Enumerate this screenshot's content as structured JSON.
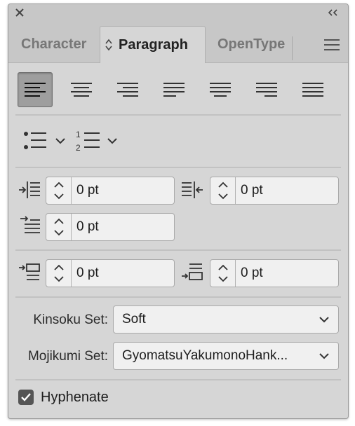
{
  "titlebar": {
    "close_icon": "close-icon",
    "collapse_icon": "double-chevron-left-icon"
  },
  "tabs": [
    {
      "label": "Character",
      "active": false
    },
    {
      "label": "Paragraph",
      "active": true,
      "icon": "up-down-arrows-icon"
    },
    {
      "label": "OpenType",
      "active": false
    }
  ],
  "panel_menu_icon": "hamburger-menu-icon",
  "alignment_buttons": [
    {
      "name": "align-left",
      "selected": true
    },
    {
      "name": "align-center",
      "selected": false
    },
    {
      "name": "align-right",
      "selected": false
    },
    {
      "name": "justify-last-left",
      "selected": false
    },
    {
      "name": "justify-last-center",
      "selected": false
    },
    {
      "name": "justify-last-right",
      "selected": false
    },
    {
      "name": "justify-all",
      "selected": false
    }
  ],
  "lists": {
    "bullets_icon": "bullet-list-icon",
    "numbers_icon": "numbered-list-icon"
  },
  "indents": {
    "left_indent": "0 pt",
    "right_indent": "0 pt",
    "first_line_indent": "0 pt"
  },
  "spacing": {
    "space_before": "0 pt",
    "space_after": "0 pt"
  },
  "kinsoku": {
    "label": "Kinsoku Set:",
    "value": "Soft"
  },
  "mojikumi": {
    "label": "Mojikumi Set:",
    "value": "GyomatsuYakumonoHank..."
  },
  "hyphenate": {
    "label": "Hyphenate",
    "checked": true
  },
  "colors": {
    "panel_bg": "#d6d6d6",
    "tabbar_bg": "#c7c7c7",
    "field_bg": "#f0f0f0",
    "selected_btn": "#9e9e9e"
  }
}
